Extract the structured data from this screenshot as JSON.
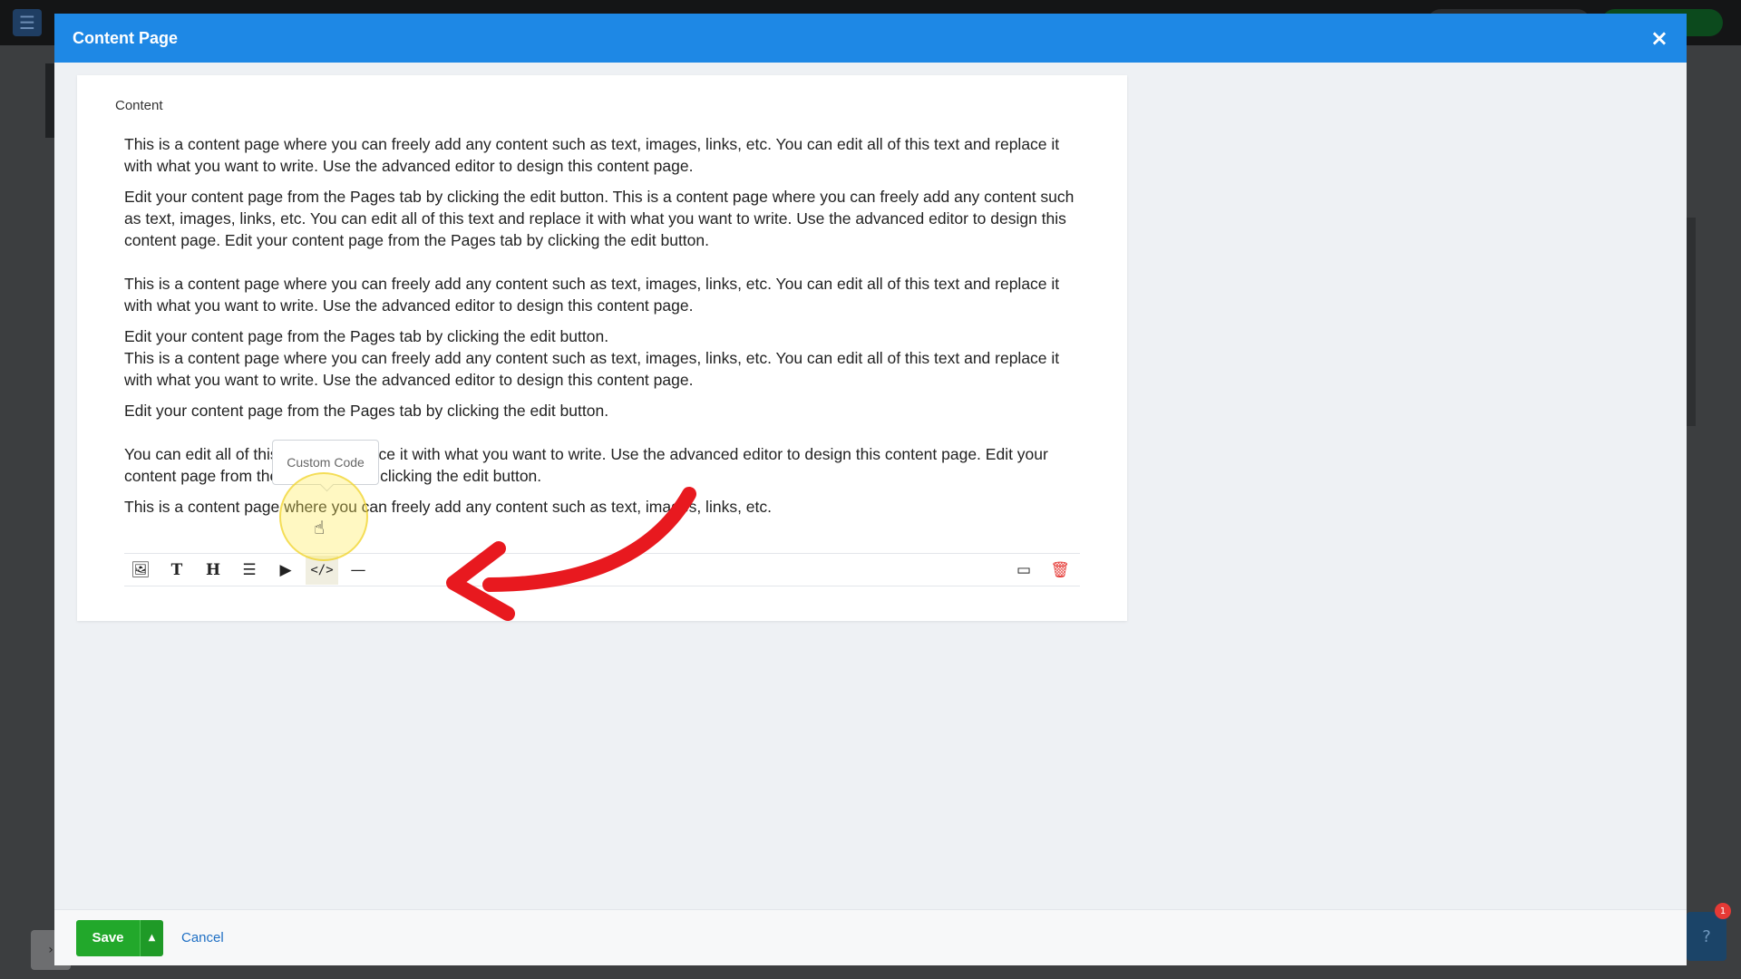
{
  "modal": {
    "title": "Content Page",
    "close_icon": "×"
  },
  "field_label": "Content",
  "paragraphs": [
    "This is a content page where you can freely add any content such as text, images, links, etc. You can edit all of this text and replace it with what you want to write. Use the advanced editor to design this content page.",
    "Edit your content page from the Pages tab by clicking the edit button. This is a content page where you can freely add any content such as text, images, links, etc. You can edit all of this text and replace it with what you want to write. Use the advanced editor to design this content page. Edit your content page from the Pages tab by clicking the edit button.",
    "This is a content page where you can freely add any content such as text, images, links, etc. You can edit all of this text and replace it with what you want to write. Use the advanced editor to design this content page.",
    "Edit your content page from the Pages tab by clicking the edit button.",
    "This is a content page where you can freely add any content such as text, images, links, etc. You can edit all of this text and replace it with what you want to write. Use the advanced editor to design this content page.",
    "Edit your content page from the Pages tab by clicking the edit button.",
    "You can edit all of this text and replace it with what you want to write. Use the advanced editor to design this content page. Edit your content page from the Pages tab by clicking the edit button.",
    "This is a content page where you can freely add any content such as text, images, links, etc."
  ],
  "toolbar": {
    "image_icon": "🖼",
    "text_icon": "T",
    "heading_icon": "H",
    "list_icon": "☰",
    "video_icon": "▶",
    "code_icon": "</>",
    "divider_icon": "—",
    "responsive_icon": "▭",
    "trash_icon": "🗑",
    "tooltip": "Custom Code"
  },
  "footer": {
    "save_label": "Save",
    "caret": "▲",
    "cancel_label": "Cancel"
  },
  "background": {
    "help_label": "?",
    "notification_count": "1",
    "side_tab": "›",
    "menu_icon": "☰"
  },
  "colors": {
    "header": "#1e88e5",
    "save": "#22a82b",
    "trash": "#e53935"
  }
}
